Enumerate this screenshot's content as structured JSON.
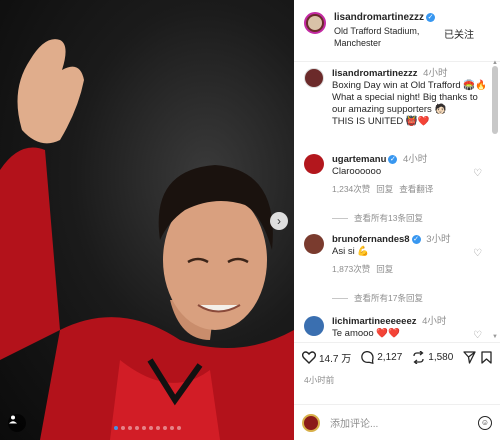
{
  "post": {
    "username": "lisandromartinezzz",
    "location": "Old Trafford Stadium, Manchester",
    "follow_label": "已关注",
    "caption_time": "4小时",
    "caption_line1": "Boxing Day win at Old Trafford 🏟️🔥",
    "caption_line2": "What a special night! Big thanks to our amazing supporters 🧑🏻",
    "caption_line3": "THIS IS UNITED 👹❤️"
  },
  "comments": [
    {
      "user": "ugartemanu",
      "time": "4小时",
      "text": "Claroooooo",
      "likes": "1,234次赞",
      "reply": "回复",
      "translate": "查看翻译",
      "view_replies": "查看所有13条回复",
      "avatar_color": "#b3171d"
    },
    {
      "user": "brunofernandes8",
      "time": "3小时",
      "text": "Asi si 💪",
      "likes": "1,873次赞",
      "reply": "回复",
      "translate": "",
      "view_replies": "查看所有17条回复",
      "avatar_color": "#7a3b2e"
    },
    {
      "user": "lichimartineeeeeez",
      "time": "4小时",
      "text": "Te amooo ❤️❤️",
      "avatar_color": "#3a6fb0"
    }
  ],
  "actions": {
    "likes": "14.7 万",
    "comments": "2,127",
    "reposts": "1,580"
  },
  "post_time": "4小时前",
  "add_comment_placeholder": "添加评论...",
  "colors": {
    "verified": "#3897f0",
    "story_ring": "#c32aa3",
    "carousel_active_dot": "#4a90e2"
  }
}
